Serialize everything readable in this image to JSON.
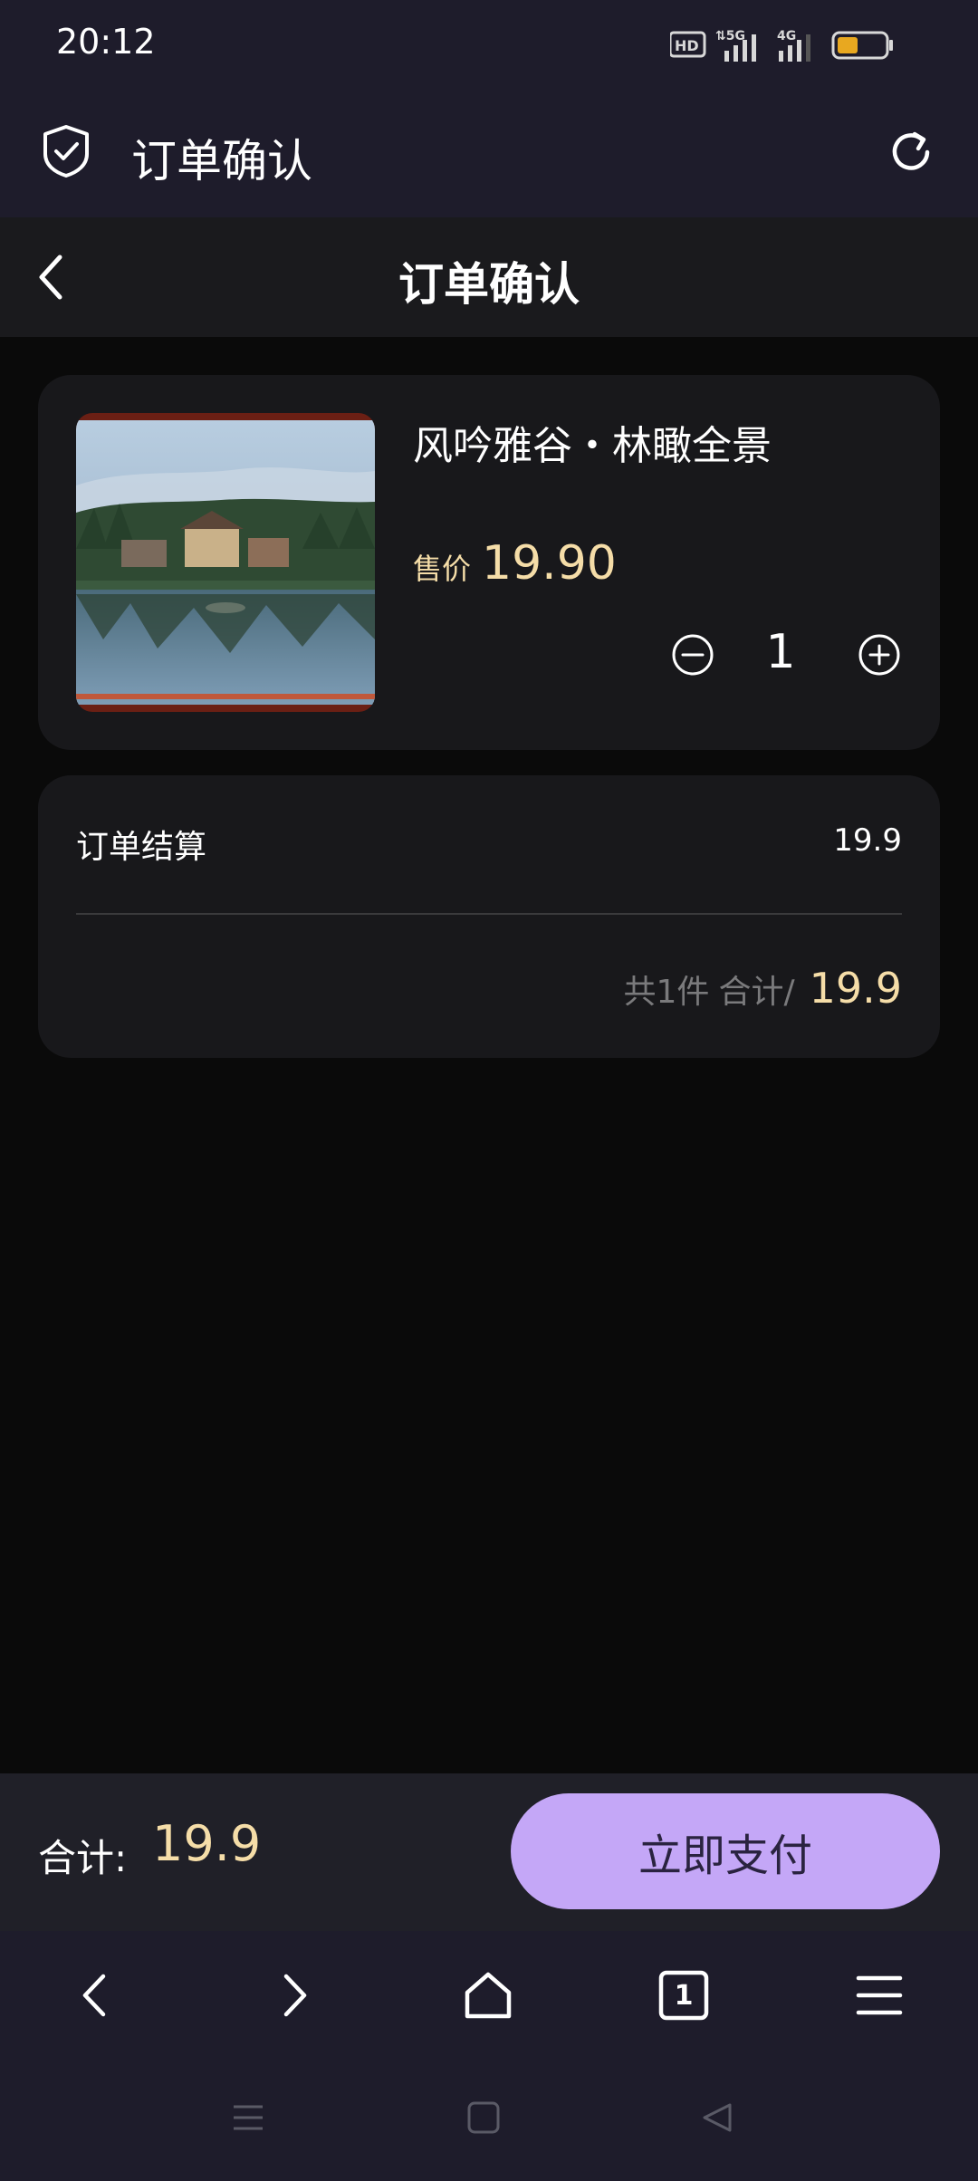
{
  "status_bar": {
    "time": "20:12",
    "icons": [
      "hd-icon",
      "5g-signal-icon",
      "4g-signal-icon",
      "battery-icon"
    ]
  },
  "browser_bar": {
    "title": "订单确认",
    "icons": [
      "shield-check-icon",
      "refresh-icon"
    ]
  },
  "page_header": {
    "title": "订单确认",
    "back_icon": "chevron-left-icon"
  },
  "product": {
    "name": "风吟雅谷・林瞰全景",
    "price_label": "售价",
    "price": "19.90",
    "quantity": "1",
    "image": "lakeside-villa-photo"
  },
  "summary": {
    "label": "订单结算",
    "value": "19.9",
    "count_text": "共1件",
    "total_label": "合计/",
    "total_value": "19.9"
  },
  "pay_bar": {
    "total_label": "合计:",
    "total_value": "19.9",
    "pay_button": "立即支付"
  },
  "browser_nav": {
    "tab_count": "1",
    "icons": [
      "back-icon",
      "forward-icon",
      "home-icon",
      "tabs-icon",
      "menu-icon"
    ]
  },
  "system_nav": {
    "icons": [
      "recents-icon",
      "home-square-icon",
      "back-triangle-icon"
    ]
  },
  "colors": {
    "accent_price": "#f5dda8",
    "pay_button": "#c4a7f7",
    "chrome_bg": "#1e1c2b",
    "card_bg": "#18181b"
  }
}
